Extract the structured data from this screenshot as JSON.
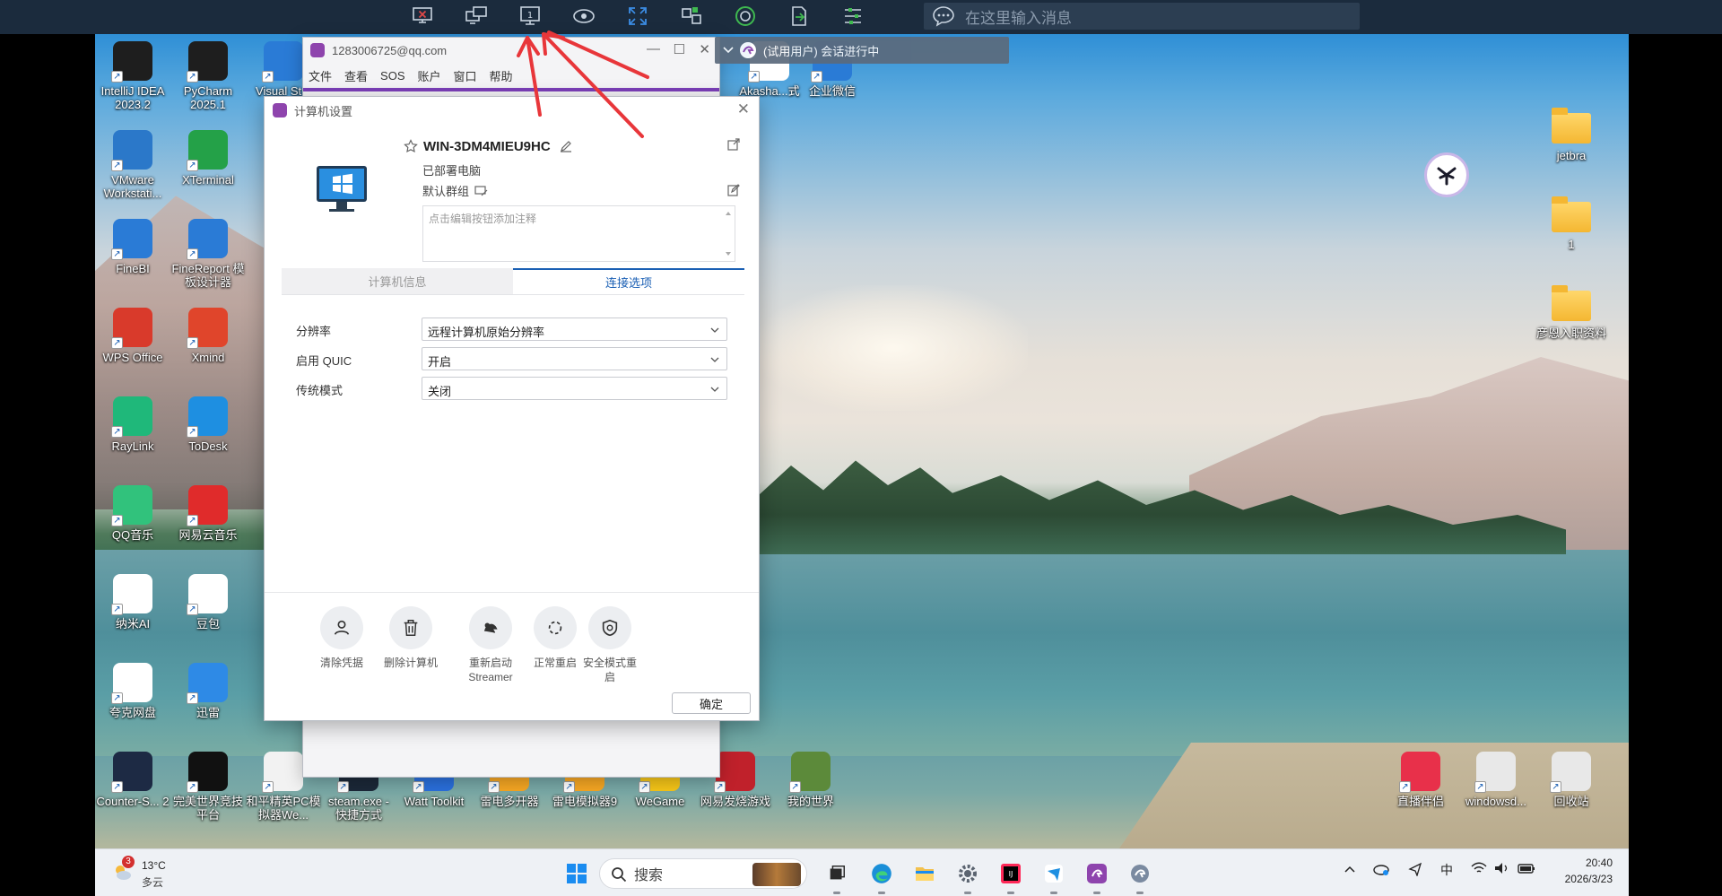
{
  "toolbar": {
    "message_placeholder": "在这里输入消息",
    "buttons": [
      "disconnect-icon",
      "switch-screen-icon",
      "monitor-1-icon",
      "view-only-icon",
      "fullscreen-icon",
      "file-transfer-icon",
      "record-icon",
      "clipboard-icon",
      "settings-icon"
    ],
    "monitor_label": "1"
  },
  "session_bar": {
    "text": "(试用用户) 会话进行中"
  },
  "client_window": {
    "title": "1283006725@qq.com",
    "menu": [
      "文件",
      "查看",
      "SOS",
      "账户",
      "窗口",
      "帮助"
    ]
  },
  "dialog": {
    "title": "计算机设置",
    "pc_name": "WIN-3DM4MIEU9HC",
    "status": "已部署电脑",
    "group": "默认群组",
    "note_placeholder": "点击编辑按钮添加注释",
    "tabs": [
      "计算机信息",
      "连接选项"
    ],
    "active_tab": "连接选项",
    "options": [
      {
        "label": "分辨率",
        "value": "远程计算机原始分辨率"
      },
      {
        "label": "启用 QUIC",
        "value": "开启"
      },
      {
        "label": "传统模式",
        "value": "关闭"
      }
    ],
    "actions": [
      {
        "label": "清除凭据",
        "icon": "user-icon"
      },
      {
        "label": "删除计算机",
        "icon": "trash-icon"
      },
      {
        "label": "重新启动 Streamer",
        "icon": "restart-streamer-icon"
      },
      {
        "label": "正常重启",
        "icon": "reboot-icon"
      },
      {
        "label": "安全模式重启",
        "icon": "shield-icon"
      }
    ],
    "ok": "确定"
  },
  "desktop": {
    "icons_left": [
      {
        "label": "IntelliJ IDEA 2023.2",
        "color": "#1e1e1e"
      },
      {
        "label": "PyCharm 2025.1",
        "color": "#1e1e1e"
      },
      {
        "label": "VMware Workstati...",
        "color": "#2b78c9"
      },
      {
        "label": "XTerminal",
        "color": "#24a148"
      },
      {
        "label": "FineBI",
        "color": "#2a7bd6"
      },
      {
        "label": "FineReport 模板设计器",
        "color": "#2a7bd6"
      },
      {
        "label": "WPS Office",
        "color": "#d93a2b"
      },
      {
        "label": "Xmind",
        "color": "#e0452b"
      },
      {
        "label": "RayLink",
        "color": "#1fb87a"
      },
      {
        "label": "ToDesk",
        "color": "#1e8fe1"
      },
      {
        "label": "QQ音乐",
        "color": "#31c27c"
      },
      {
        "label": "网易云音乐",
        "color": "#e02b2b"
      },
      {
        "label": "纳米AI",
        "color": "#ffffff"
      },
      {
        "label": "豆包",
        "color": "#ffffff"
      },
      {
        "label": "夸克网盘",
        "color": "#ffffff"
      },
      {
        "label": "迅雷",
        "color": "#2e8ae6"
      },
      {
        "label": "Counter-S... 2",
        "color": "#1d2a44"
      },
      {
        "label": "完美世界竞技平台",
        "color": "#111111"
      },
      {
        "label": "和平精英PC模拟器We...",
        "color": "#f2f2f2"
      }
    ],
    "icons_bottom": [
      {
        "label": "steam.exe - 快捷方式",
        "color": "#1b2838"
      },
      {
        "label": "Watt Toolkit",
        "color": "#2a6fdb"
      },
      {
        "label": "雷电多开器",
        "color": "#f5a623"
      },
      {
        "label": "雷电模拟器9",
        "color": "#f5a623"
      },
      {
        "label": "WeGame",
        "color": "#f5c518"
      },
      {
        "label": "网易发烧游戏",
        "color": "#c0212b"
      },
      {
        "label": "我的世界",
        "color": "#5c8a3a"
      }
    ],
    "icons_top_mid": [
      {
        "label": "Visual St...",
        "color": "#2a7bd6"
      },
      {
        "label": "Akasha...式",
        "color": "#ffffff"
      },
      {
        "label": "企业微信",
        "color": "#2a7bd6"
      }
    ],
    "icons_right": [
      {
        "label": "jetbra"
      },
      {
        "label": "1"
      },
      {
        "label": "彦恩入职资料"
      }
    ],
    "icons_bottom_right": [
      {
        "label": "直播伴侣",
        "color": "#e8304a"
      },
      {
        "label": "windowsd...",
        "color": "#e8e8e8"
      },
      {
        "label": "回收站",
        "color": "#e8e8e8"
      }
    ]
  },
  "taskbar": {
    "weather_temp": "13°C",
    "weather_desc": "多云",
    "weather_badge": "3",
    "search_placeholder": "搜索",
    "tray_ime": "中",
    "time": "20:40",
    "date": "2026/3/23"
  }
}
